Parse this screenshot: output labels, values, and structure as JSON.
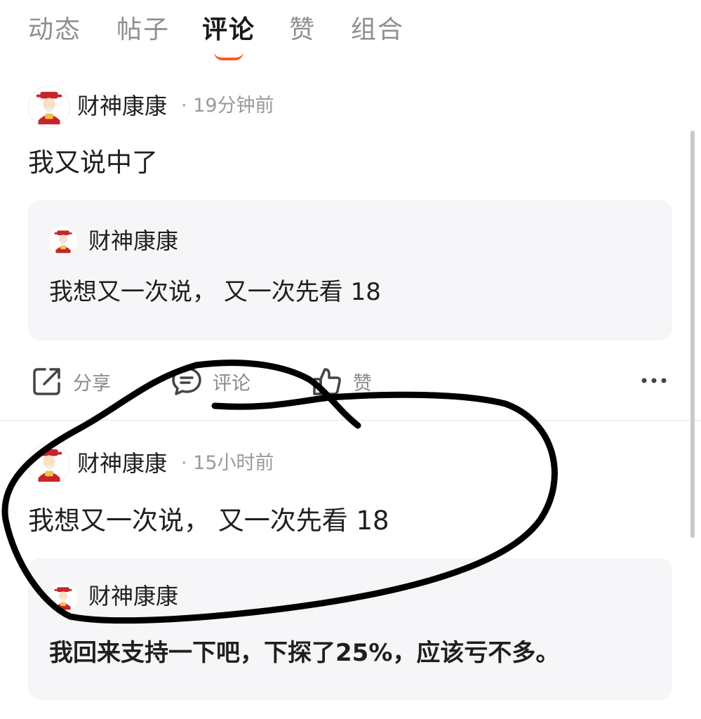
{
  "tabs": [
    {
      "label": "动态",
      "active": false
    },
    {
      "label": "帖子",
      "active": false
    },
    {
      "label": "评论",
      "active": true
    },
    {
      "label": "赞",
      "active": false
    },
    {
      "label": "组合",
      "active": false
    }
  ],
  "accent_color": "#ff5a1f",
  "posts": [
    {
      "author": "财神康康",
      "time": "· 19分钟前",
      "text": "我又说中了",
      "quote": {
        "author": "财神康康",
        "text": "我想又一次说， 又一次先看 18"
      }
    },
    {
      "author": "财神康康",
      "time": "· 15小时前",
      "text": "我想又一次说， 又一次先看 18",
      "quote": {
        "author": "财神康康",
        "text": "我回来支持一下吧，下探了25%，应该亏不多。"
      }
    }
  ],
  "actions": {
    "share": "分享",
    "comment": "评论",
    "like": "赞",
    "more_icon": "more-icon"
  },
  "icons": {
    "avatar": "caishen-avatar-icon",
    "share": "share-icon",
    "comment": "comment-icon",
    "like": "thumbs-up-icon"
  }
}
